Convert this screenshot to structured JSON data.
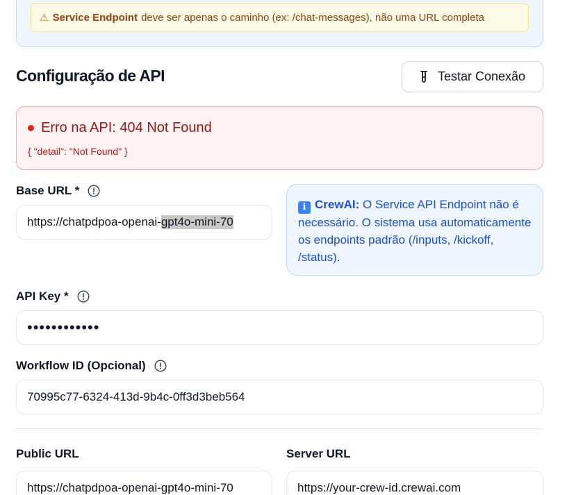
{
  "warning": {
    "icon": "warning-icon",
    "bold": "Service Endpoint",
    "text": "deve ser apenas o caminho (ex: /chat-messages), não uma URL completa"
  },
  "section": {
    "title": "Configuração de API",
    "test_button": {
      "icon": "test-tube-icon",
      "label": "Testar Conexão"
    }
  },
  "error": {
    "title": "Erro na API: 404 Not Found",
    "detail": "{ \"detail\": \"Not Found\" }"
  },
  "base_url": {
    "label": "Base URL *",
    "value_plain": "https://chatpdpoa-openai-",
    "value_selected": "gpt4o-mini-70"
  },
  "crewai_note": {
    "bold": "CrewAI:",
    "text": "O Service API Endpoint não é necessário. O sistema usa automaticamente os endpoints padrão (/inputs, /kickoff, /status)."
  },
  "api_key": {
    "label": "API Key *",
    "value": "••••••••••••"
  },
  "workflow_id": {
    "label": "Workflow ID (Opcional)",
    "value": "70995c77-6324-413d-9b4c-0ff3d3beb564"
  },
  "public_url": {
    "label": "Public URL",
    "value": "https://chatpdpoa-openai-gpt4o-mini-70"
  },
  "server_url": {
    "label": "Server URL",
    "value": "https://your-crew-id.crewai.com"
  },
  "colors": {
    "error": "#dc2626",
    "info": "#1d4ed8",
    "warning": "#92400e"
  }
}
